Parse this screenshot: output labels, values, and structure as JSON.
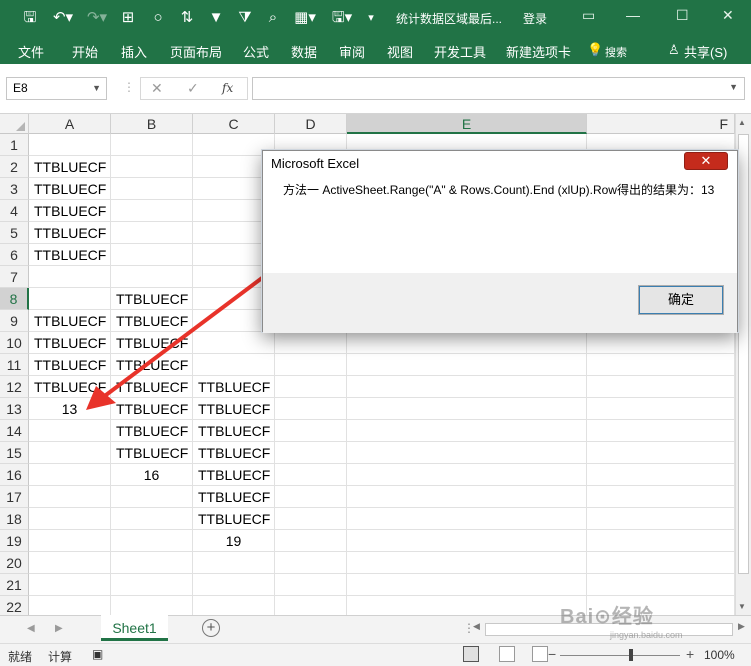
{
  "titlebar": {
    "title": "统计数据区域最后...",
    "login": "登录",
    "bg_color": "#217346"
  },
  "ribbon_tabs": [
    {
      "label": "文件"
    },
    {
      "label": "开始"
    },
    {
      "label": "插入"
    },
    {
      "label": "页面布局"
    },
    {
      "label": "公式"
    },
    {
      "label": "数据"
    },
    {
      "label": "审阅"
    },
    {
      "label": "视图"
    },
    {
      "label": "开发工具"
    },
    {
      "label": "新建选项卡"
    },
    {
      "label": "搜索"
    },
    {
      "label": "共享(S)"
    }
  ],
  "formula_bar": {
    "name_box": "E8",
    "fx_label": "fx",
    "formula": ""
  },
  "columns": [
    "A",
    "B",
    "C",
    "D",
    "E",
    "F"
  ],
  "selected_column": "E",
  "selected_row": "8",
  "rows": [
    {
      "n": "1",
      "a": "",
      "b": "",
      "c": ""
    },
    {
      "n": "2",
      "a": "TTBLUECF",
      "b": "",
      "c": ""
    },
    {
      "n": "3",
      "a": "TTBLUECF",
      "b": "",
      "c": ""
    },
    {
      "n": "4",
      "a": "TTBLUECF",
      "b": "",
      "c": ""
    },
    {
      "n": "5",
      "a": "TTBLUECF",
      "b": "",
      "c": ""
    },
    {
      "n": "6",
      "a": "TTBLUECF",
      "b": "",
      "c": ""
    },
    {
      "n": "7",
      "a": "",
      "b": "",
      "c": ""
    },
    {
      "n": "8",
      "a": "",
      "b": "TTBLUECF",
      "c": ""
    },
    {
      "n": "9",
      "a": "TTBLUECF",
      "b": "TTBLUECF",
      "c": ""
    },
    {
      "n": "10",
      "a": "TTBLUECF",
      "b": "TTBLUECF",
      "c": ""
    },
    {
      "n": "11",
      "a": "TTBLUECF",
      "b": "TTBLUECF",
      "c": ""
    },
    {
      "n": "12",
      "a": "TTBLUECF",
      "b": "TTBLUECF",
      "c": "TTBLUECF"
    },
    {
      "n": "13",
      "a": "13",
      "b": "TTBLUECF",
      "c": "TTBLUECF"
    },
    {
      "n": "14",
      "a": "",
      "b": "TTBLUECF",
      "c": "TTBLUECF"
    },
    {
      "n": "15",
      "a": "",
      "b": "TTBLUECF",
      "c": "TTBLUECF"
    },
    {
      "n": "16",
      "a": "",
      "b": "16",
      "c": "TTBLUECF"
    },
    {
      "n": "17",
      "a": "",
      "b": "",
      "c": "TTBLUECF"
    },
    {
      "n": "18",
      "a": "",
      "b": "",
      "c": "TTBLUECF"
    },
    {
      "n": "19",
      "a": "",
      "b": "",
      "c": "19"
    },
    {
      "n": "20",
      "a": "",
      "b": "",
      "c": ""
    },
    {
      "n": "21",
      "a": "",
      "b": "",
      "c": ""
    },
    {
      "n": "22",
      "a": "",
      "b": "",
      "c": ""
    }
  ],
  "sheet_tab": "Sheet1",
  "status": {
    "ready": "就绪",
    "calc": "计算",
    "zoom": "100%"
  },
  "dialog": {
    "title": "Microsoft Excel",
    "close": "✕",
    "message": "方法一  ActiveSheet.Range(\"A\" & Rows.Count).End (xlUp).Row得出的结果为：13",
    "ok": "确定"
  },
  "watermark": {
    "text": "Bai⊙经验",
    "sub": "jingyan.baidu.com"
  }
}
